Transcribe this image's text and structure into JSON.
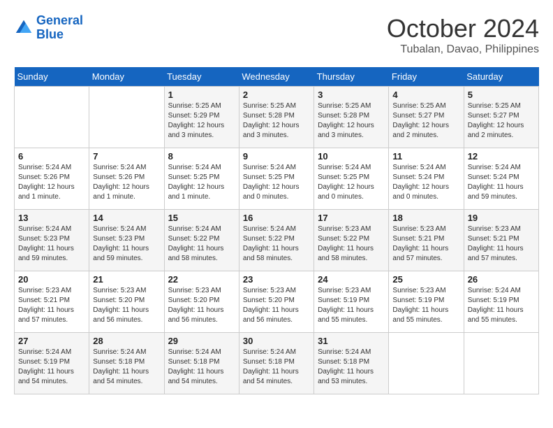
{
  "header": {
    "logo_line1": "General",
    "logo_line2": "Blue",
    "month": "October 2024",
    "location": "Tubalan, Davao, Philippines"
  },
  "weekdays": [
    "Sunday",
    "Monday",
    "Tuesday",
    "Wednesday",
    "Thursday",
    "Friday",
    "Saturday"
  ],
  "weeks": [
    [
      {
        "day": "",
        "info": ""
      },
      {
        "day": "",
        "info": ""
      },
      {
        "day": "1",
        "info": "Sunrise: 5:25 AM\nSunset: 5:29 PM\nDaylight: 12 hours\nand 3 minutes."
      },
      {
        "day": "2",
        "info": "Sunrise: 5:25 AM\nSunset: 5:28 PM\nDaylight: 12 hours\nand 3 minutes."
      },
      {
        "day": "3",
        "info": "Sunrise: 5:25 AM\nSunset: 5:28 PM\nDaylight: 12 hours\nand 3 minutes."
      },
      {
        "day": "4",
        "info": "Sunrise: 5:25 AM\nSunset: 5:27 PM\nDaylight: 12 hours\nand 2 minutes."
      },
      {
        "day": "5",
        "info": "Sunrise: 5:25 AM\nSunset: 5:27 PM\nDaylight: 12 hours\nand 2 minutes."
      }
    ],
    [
      {
        "day": "6",
        "info": "Sunrise: 5:24 AM\nSunset: 5:26 PM\nDaylight: 12 hours\nand 1 minute."
      },
      {
        "day": "7",
        "info": "Sunrise: 5:24 AM\nSunset: 5:26 PM\nDaylight: 12 hours\nand 1 minute."
      },
      {
        "day": "8",
        "info": "Sunrise: 5:24 AM\nSunset: 5:25 PM\nDaylight: 12 hours\nand 1 minute."
      },
      {
        "day": "9",
        "info": "Sunrise: 5:24 AM\nSunset: 5:25 PM\nDaylight: 12 hours\nand 0 minutes."
      },
      {
        "day": "10",
        "info": "Sunrise: 5:24 AM\nSunset: 5:25 PM\nDaylight: 12 hours\nand 0 minutes."
      },
      {
        "day": "11",
        "info": "Sunrise: 5:24 AM\nSunset: 5:24 PM\nDaylight: 12 hours\nand 0 minutes."
      },
      {
        "day": "12",
        "info": "Sunrise: 5:24 AM\nSunset: 5:24 PM\nDaylight: 11 hours\nand 59 minutes."
      }
    ],
    [
      {
        "day": "13",
        "info": "Sunrise: 5:24 AM\nSunset: 5:23 PM\nDaylight: 11 hours\nand 59 minutes."
      },
      {
        "day": "14",
        "info": "Sunrise: 5:24 AM\nSunset: 5:23 PM\nDaylight: 11 hours\nand 59 minutes."
      },
      {
        "day": "15",
        "info": "Sunrise: 5:24 AM\nSunset: 5:22 PM\nDaylight: 11 hours\nand 58 minutes."
      },
      {
        "day": "16",
        "info": "Sunrise: 5:24 AM\nSunset: 5:22 PM\nDaylight: 11 hours\nand 58 minutes."
      },
      {
        "day": "17",
        "info": "Sunrise: 5:23 AM\nSunset: 5:22 PM\nDaylight: 11 hours\nand 58 minutes."
      },
      {
        "day": "18",
        "info": "Sunrise: 5:23 AM\nSunset: 5:21 PM\nDaylight: 11 hours\nand 57 minutes."
      },
      {
        "day": "19",
        "info": "Sunrise: 5:23 AM\nSunset: 5:21 PM\nDaylight: 11 hours\nand 57 minutes."
      }
    ],
    [
      {
        "day": "20",
        "info": "Sunrise: 5:23 AM\nSunset: 5:21 PM\nDaylight: 11 hours\nand 57 minutes."
      },
      {
        "day": "21",
        "info": "Sunrise: 5:23 AM\nSunset: 5:20 PM\nDaylight: 11 hours\nand 56 minutes."
      },
      {
        "day": "22",
        "info": "Sunrise: 5:23 AM\nSunset: 5:20 PM\nDaylight: 11 hours\nand 56 minutes."
      },
      {
        "day": "23",
        "info": "Sunrise: 5:23 AM\nSunset: 5:20 PM\nDaylight: 11 hours\nand 56 minutes."
      },
      {
        "day": "24",
        "info": "Sunrise: 5:23 AM\nSunset: 5:19 PM\nDaylight: 11 hours\nand 55 minutes."
      },
      {
        "day": "25",
        "info": "Sunrise: 5:23 AM\nSunset: 5:19 PM\nDaylight: 11 hours\nand 55 minutes."
      },
      {
        "day": "26",
        "info": "Sunrise: 5:24 AM\nSunset: 5:19 PM\nDaylight: 11 hours\nand 55 minutes."
      }
    ],
    [
      {
        "day": "27",
        "info": "Sunrise: 5:24 AM\nSunset: 5:19 PM\nDaylight: 11 hours\nand 54 minutes."
      },
      {
        "day": "28",
        "info": "Sunrise: 5:24 AM\nSunset: 5:18 PM\nDaylight: 11 hours\nand 54 minutes."
      },
      {
        "day": "29",
        "info": "Sunrise: 5:24 AM\nSunset: 5:18 PM\nDaylight: 11 hours\nand 54 minutes."
      },
      {
        "day": "30",
        "info": "Sunrise: 5:24 AM\nSunset: 5:18 PM\nDaylight: 11 hours\nand 54 minutes."
      },
      {
        "day": "31",
        "info": "Sunrise: 5:24 AM\nSunset: 5:18 PM\nDaylight: 11 hours\nand 53 minutes."
      },
      {
        "day": "",
        "info": ""
      },
      {
        "day": "",
        "info": ""
      }
    ]
  ]
}
